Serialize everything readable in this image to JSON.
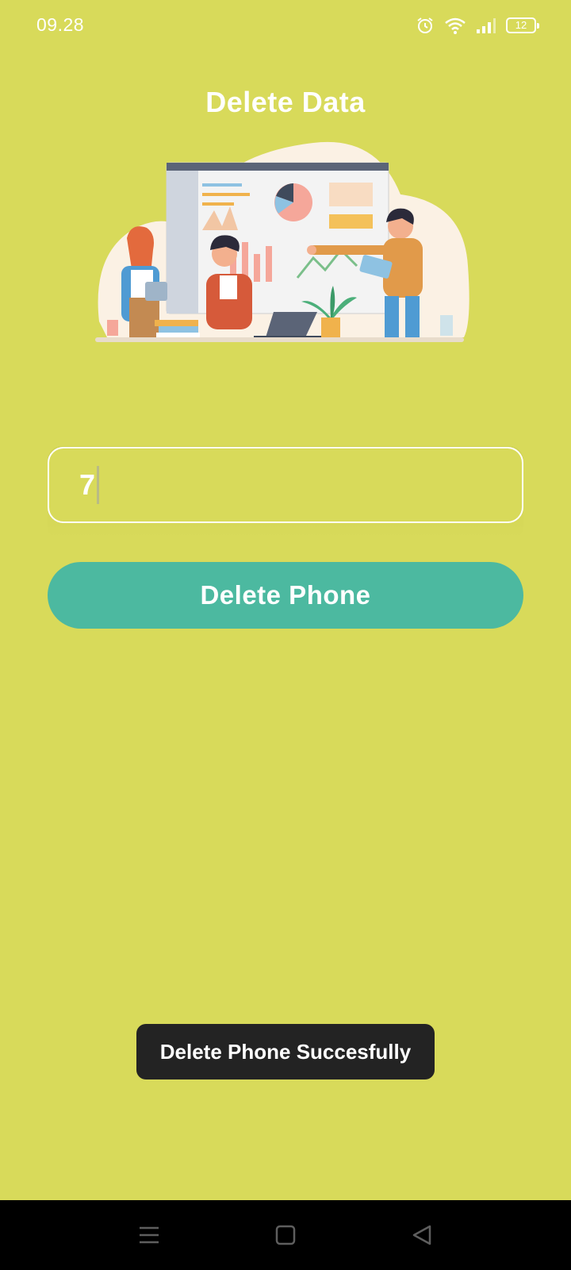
{
  "status_bar": {
    "time": "09.28",
    "battery": "12",
    "icons": [
      "alarm-icon",
      "wifi-icon",
      "signal-icon",
      "battery-icon"
    ]
  },
  "page": {
    "title": "Delete Data"
  },
  "form": {
    "input_value": "7",
    "button_label": "Delete Phone"
  },
  "toast": {
    "message": "Delete Phone Succesfully"
  },
  "nav_bar": {
    "buttons": [
      "menu-icon",
      "home-icon",
      "back-icon"
    ]
  },
  "colors": {
    "background": "#d8da5a",
    "button": "#4cb9a0",
    "toast": "#232323"
  }
}
